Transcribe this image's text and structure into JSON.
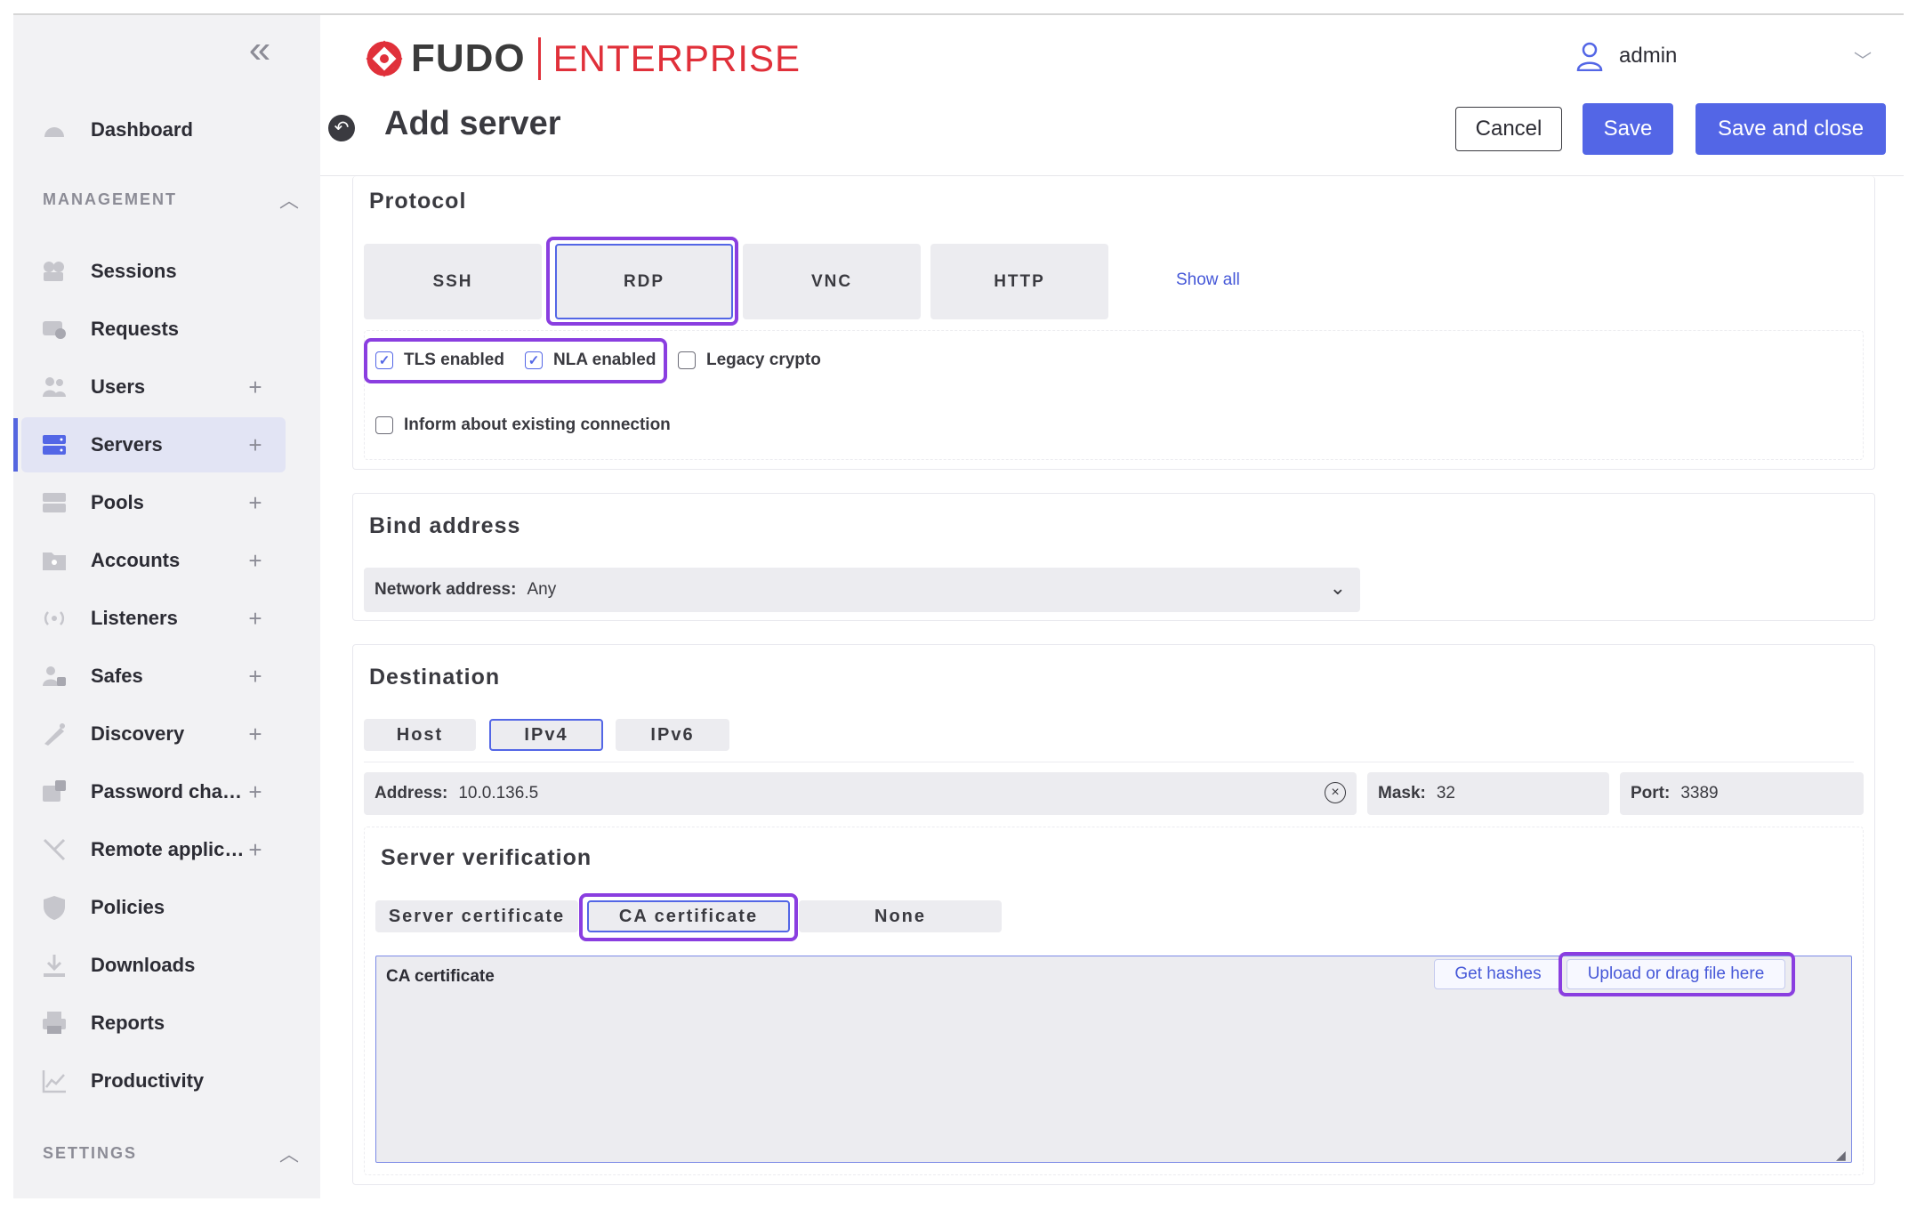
{
  "app": {
    "brand_left": "FUDO",
    "brand_right": "ENTERPRISE",
    "user": "admin",
    "page_title": "Add server"
  },
  "header_buttons": {
    "cancel": "Cancel",
    "save": "Save",
    "save_close": "Save and close"
  },
  "sidebar": {
    "dashboard": "Dashboard",
    "management_heading": "MANAGEMENT",
    "settings_heading": "SETTINGS",
    "items": [
      {
        "label": "Sessions",
        "icon": "sessions-icon",
        "plus": false
      },
      {
        "label": "Requests",
        "icon": "requests-icon",
        "plus": false
      },
      {
        "label": "Users",
        "icon": "users-icon",
        "plus": true
      },
      {
        "label": "Servers",
        "icon": "servers-icon",
        "plus": true,
        "active": true
      },
      {
        "label": "Pools",
        "icon": "pools-icon",
        "plus": true
      },
      {
        "label": "Accounts",
        "icon": "accounts-icon",
        "plus": true
      },
      {
        "label": "Listeners",
        "icon": "listeners-icon",
        "plus": true
      },
      {
        "label": "Safes",
        "icon": "safes-icon",
        "plus": true
      },
      {
        "label": "Discovery",
        "icon": "discovery-icon",
        "plus": true
      },
      {
        "label": "Password changers",
        "icon": "password-changers-icon",
        "plus": true
      },
      {
        "label": "Remote applicati...",
        "icon": "remote-applications-icon",
        "plus": true
      },
      {
        "label": "Policies",
        "icon": "policies-icon",
        "plus": false
      },
      {
        "label": "Downloads",
        "icon": "downloads-icon",
        "plus": false
      },
      {
        "label": "Reports",
        "icon": "reports-icon",
        "plus": false
      },
      {
        "label": "Productivity",
        "icon": "productivity-icon",
        "plus": false
      }
    ]
  },
  "protocol": {
    "heading": "Protocol",
    "options": [
      "SSH",
      "RDP",
      "VNC",
      "HTTP"
    ],
    "selected": "RDP",
    "show_all": "Show all",
    "checkboxes": [
      {
        "label": "TLS enabled",
        "checked": true
      },
      {
        "label": "NLA enabled",
        "checked": true
      },
      {
        "label": "Legacy crypto",
        "checked": false
      }
    ],
    "inform_label": "Inform about existing connection",
    "inform_checked": false
  },
  "bind": {
    "heading": "Bind address",
    "label": "Network address:",
    "value": "Any"
  },
  "destination": {
    "heading": "Destination",
    "types": [
      "Host",
      "IPv4",
      "IPv6"
    ],
    "selected": "IPv4",
    "address_label": "Address:",
    "address_value": "10.0.136.5",
    "mask_label": "Mask:",
    "mask_value": "32",
    "port_label": "Port:",
    "port_value": "3389"
  },
  "verification": {
    "heading": "Server verification",
    "options": [
      "Server certificate",
      "CA certificate",
      "None"
    ],
    "selected": "CA certificate",
    "textarea_label": "CA certificate",
    "get_hashes": "Get hashes",
    "upload": "Upload or drag file here"
  },
  "colors": {
    "accent": "#5366e6",
    "brand_red": "#e0303a",
    "highlight": "#8a3ee0"
  }
}
